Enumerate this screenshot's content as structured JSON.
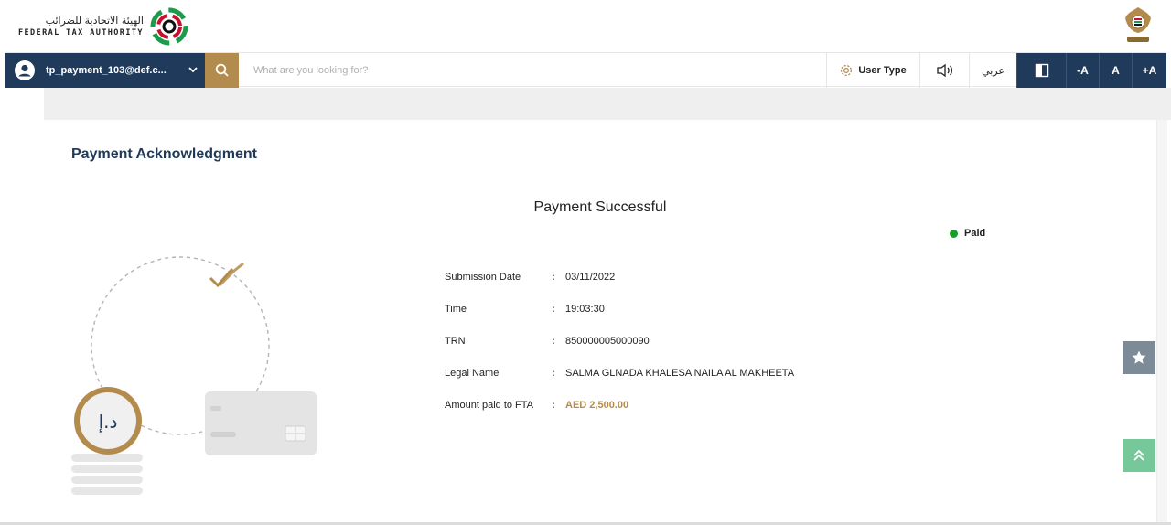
{
  "header": {
    "logo_arabic": "الهيئة الاتحادية للضرائب",
    "logo_english": "FEDERAL TAX AUTHORITY"
  },
  "navbar": {
    "user_name": "tp_payment_103@def.c...",
    "search_placeholder": "What are you looking for?",
    "user_type_label": "User Type",
    "language_label": "عربي",
    "font_decrease": "-A",
    "font_normal": "A",
    "font_increase": "+A"
  },
  "main": {
    "page_title": "Payment Acknowledgment",
    "success_title": "Payment Successful",
    "status_label": "Paid",
    "details": [
      {
        "label": "Submission Date",
        "value": "03/11/2022"
      },
      {
        "label": "Time",
        "value": "19:03:30"
      },
      {
        "label": "TRN",
        "value": "850000005000090"
      },
      {
        "label": "Legal Name",
        "value": "SALMA GLNADA KHALESA NAILA AL MAKHEETA"
      },
      {
        "label": "Amount paid to FTA",
        "value": "AED 2,500.00"
      }
    ],
    "separator": ":",
    "coin_symbol": "د.إ"
  },
  "colors": {
    "primary_navy": "#1f3a5a",
    "accent_gold": "#b38b4d",
    "status_green": "#1a9c2a",
    "favorite_gray": "#7d8b99",
    "scroll_top_green": "#76c79a"
  },
  "icons": {
    "user": "user-avatar-icon",
    "chevron": "chevron-down-icon",
    "search": "search-icon",
    "settings": "gear-icon",
    "audio": "speaker-icon",
    "contrast": "contrast-icon",
    "favorite": "star-icon",
    "scroll_top": "double-chevron-up-icon"
  }
}
